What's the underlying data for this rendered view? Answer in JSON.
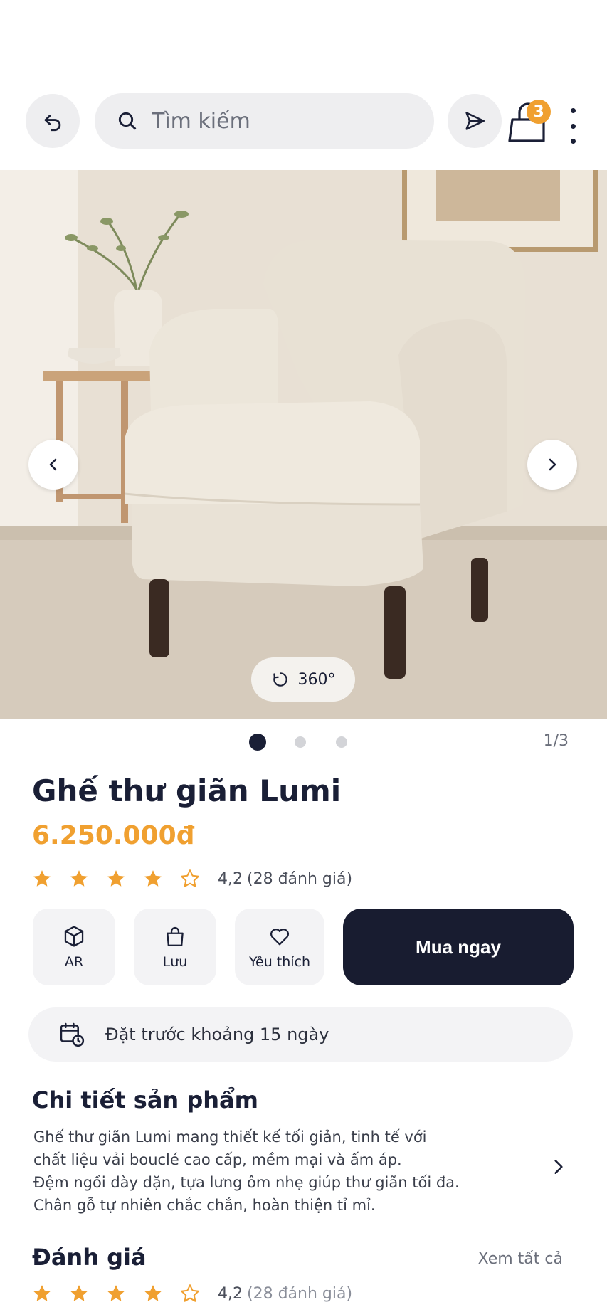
{
  "header": {
    "search_placeholder": "Tìm kiếm",
    "cart_count": "3"
  },
  "gallery": {
    "view360_label": "360°",
    "counter": "1/3",
    "current_index": 1,
    "total": 3
  },
  "product": {
    "title": "Ghế thư giãn Lumi",
    "price": "6.250.000đ",
    "rating": 4.2,
    "rating_value": "4,2",
    "rating_count": "(28 đánh giá)"
  },
  "actions": {
    "ar_label": "AR",
    "save_label": "Lưu",
    "favorite_label": "Yêu thích",
    "buy_label": "Mua ngay"
  },
  "preorder": {
    "text": "Đặt trước khoảng 15 ngày"
  },
  "details": {
    "title": "Chi tiết sản phẩm",
    "lines": [
      "Ghế thư giãn Lumi mang thiết kế tối giản, tinh tế với",
      "chất liệu vải bouclé cao cấp, mềm mại và ấm áp.",
      "Đệm ngồi dày dặn, tựa lưng ôm nhẹ giúp thư giãn tối đa.",
      "Chân gỗ tự nhiên chắc chắn, hoàn thiện tỉ mỉ."
    ]
  },
  "reviews": {
    "title": "Đánh giá",
    "see_all": "Xem tất cả",
    "rating_value": "4,2",
    "rating_count": "(28 đánh giá)"
  },
  "colors": {
    "accent": "#f0a030",
    "dark": "#181c30",
    "chip_bg": "#f3f3f5"
  },
  "icons": [
    "back-arrow-icon",
    "search-icon",
    "send-icon",
    "shopping-bag-icon",
    "more-vertical-icon",
    "chevron-left-icon",
    "chevron-right-icon",
    "rotate-icon",
    "star-icon",
    "star-outline-icon",
    "cube-icon",
    "bag-icon",
    "heart-icon",
    "calendar-clock-icon"
  ]
}
